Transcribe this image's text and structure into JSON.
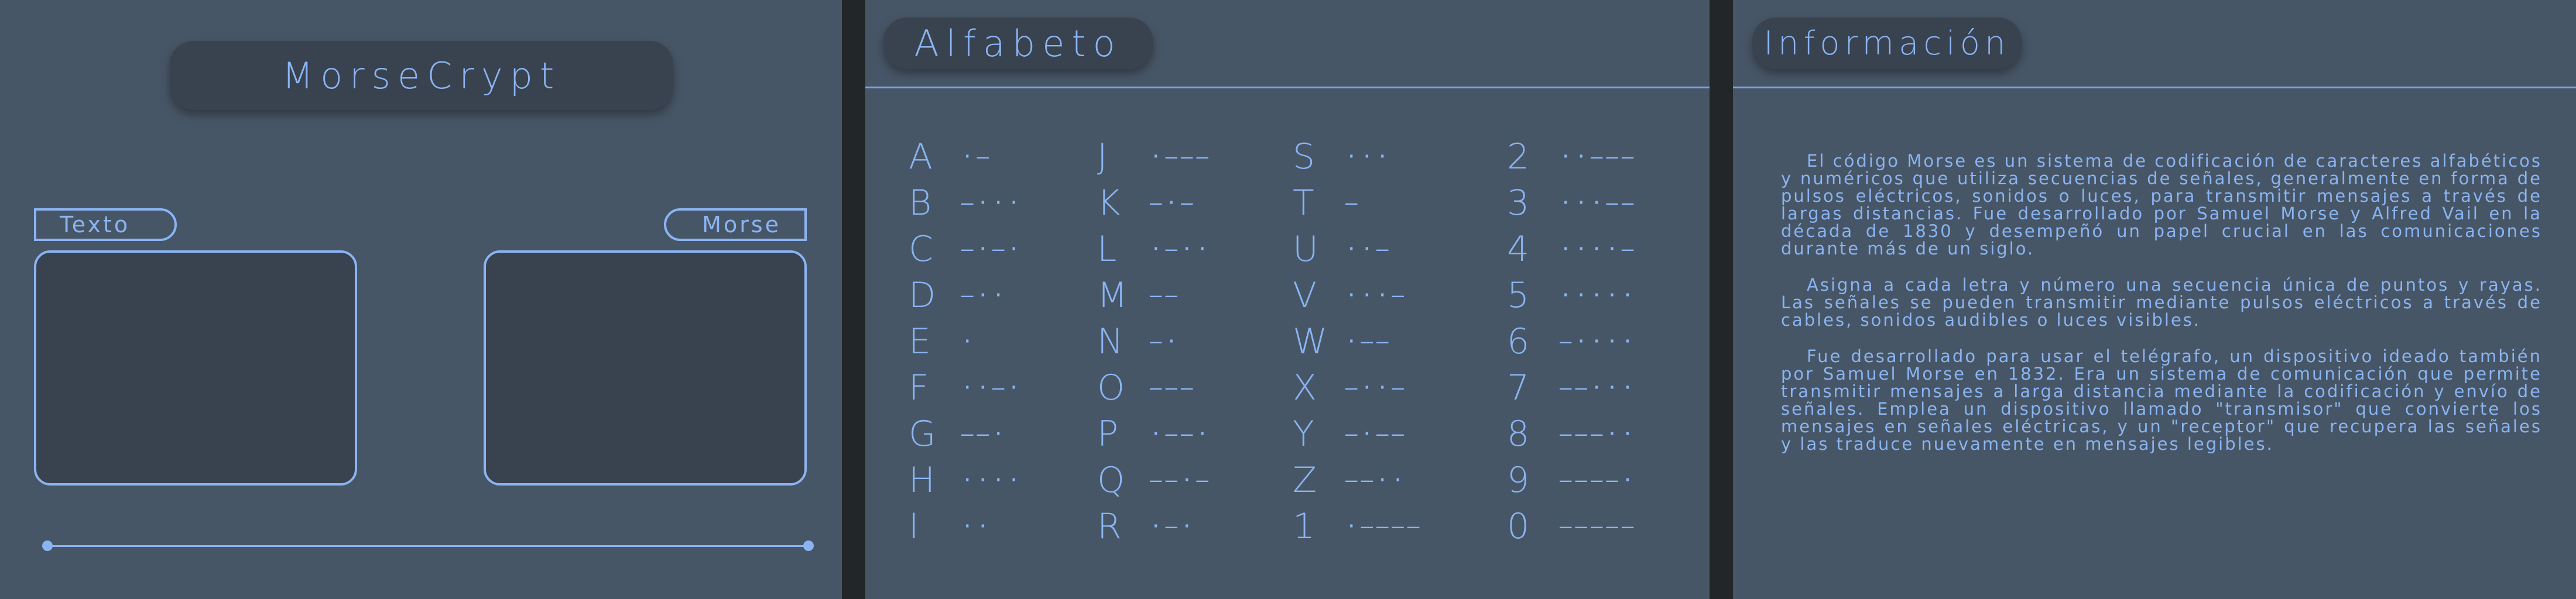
{
  "app": {
    "title": "MorseCrypt"
  },
  "converter": {
    "text_label": "Texto",
    "morse_label": "Morse",
    "text_value": "",
    "morse_value": ""
  },
  "alphabet": {
    "title": "Alfabeto",
    "columns": [
      [
        {
          "char": "A",
          "code": "·–"
        },
        {
          "char": "B",
          "code": "–···"
        },
        {
          "char": "C",
          "code": "–·–·"
        },
        {
          "char": "D",
          "code": "–··"
        },
        {
          "char": "E",
          "code": "·"
        },
        {
          "char": "F",
          "code": "··–·"
        },
        {
          "char": "G",
          "code": "––·"
        },
        {
          "char": "H",
          "code": "····"
        },
        {
          "char": "I",
          "code": "··"
        }
      ],
      [
        {
          "char": "J",
          "code": "·–––"
        },
        {
          "char": "K",
          "code": "–·–"
        },
        {
          "char": "L",
          "code": "·–··"
        },
        {
          "char": "M",
          "code": "––"
        },
        {
          "char": "N",
          "code": "–·"
        },
        {
          "char": "O",
          "code": "–––"
        },
        {
          "char": "P",
          "code": "·––·"
        },
        {
          "char": "Q",
          "code": "––·–"
        },
        {
          "char": "R",
          "code": "·–·"
        }
      ],
      [
        {
          "char": "S",
          "code": "···"
        },
        {
          "char": "T",
          "code": "–"
        },
        {
          "char": "U",
          "code": "··–"
        },
        {
          "char": "V",
          "code": "···–"
        },
        {
          "char": "W",
          "code": "·––"
        },
        {
          "char": "X",
          "code": "–··–"
        },
        {
          "char": "Y",
          "code": "–·––"
        },
        {
          "char": "Z",
          "code": "––··"
        },
        {
          "char": "1",
          "code": "·––––"
        }
      ],
      [
        {
          "char": "2",
          "code": "··–––"
        },
        {
          "char": "3",
          "code": "···––"
        },
        {
          "char": "4",
          "code": "····–"
        },
        {
          "char": "5",
          "code": "·····"
        },
        {
          "char": "6",
          "code": "–····"
        },
        {
          "char": "7",
          "code": "––···"
        },
        {
          "char": "8",
          "code": "–––··"
        },
        {
          "char": "9",
          "code": "––––·"
        },
        {
          "char": "0",
          "code": "–––––"
        }
      ]
    ]
  },
  "info": {
    "title": "Información",
    "paragraphs": [
      "El código Morse es un sistema de codificación de caracteres alfabéticos y numéricos que utiliza secuencias de señales, generalmente en forma de pulsos eléctricos, sonidos o luces, para transmitir mensajes a través de largas distancias. Fue desarrollado por Samuel Morse y Alfred Vail en la década de 1830 y desempeñó un papel crucial en las comunicaciones durante más de un siglo.",
      "Asigna a cada letra y número una secuencia única de puntos y rayas. Las señales se pueden transmitir mediante pulsos eléctricos a través de cables, sonidos audibles o luces visibles.",
      "Fue desarrollado para usar el telégrafo, un dispositivo ideado también por Samuel Morse en 1832. Era un sistema de comunicación que permite transmitir mensajes a larga distancia mediante la codificación y envío de señales. Emplea un dispositivo llamado \"transmisor\" que convierte los mensajes en señales eléctricas, y un \"receptor\" que recupera las señales y las traduce nuevamente en mensajes legibles."
    ]
  },
  "colors": {
    "panel": "#475666",
    "accent": "#8ab4f2",
    "box": "#39424f",
    "gap": "#232629"
  }
}
